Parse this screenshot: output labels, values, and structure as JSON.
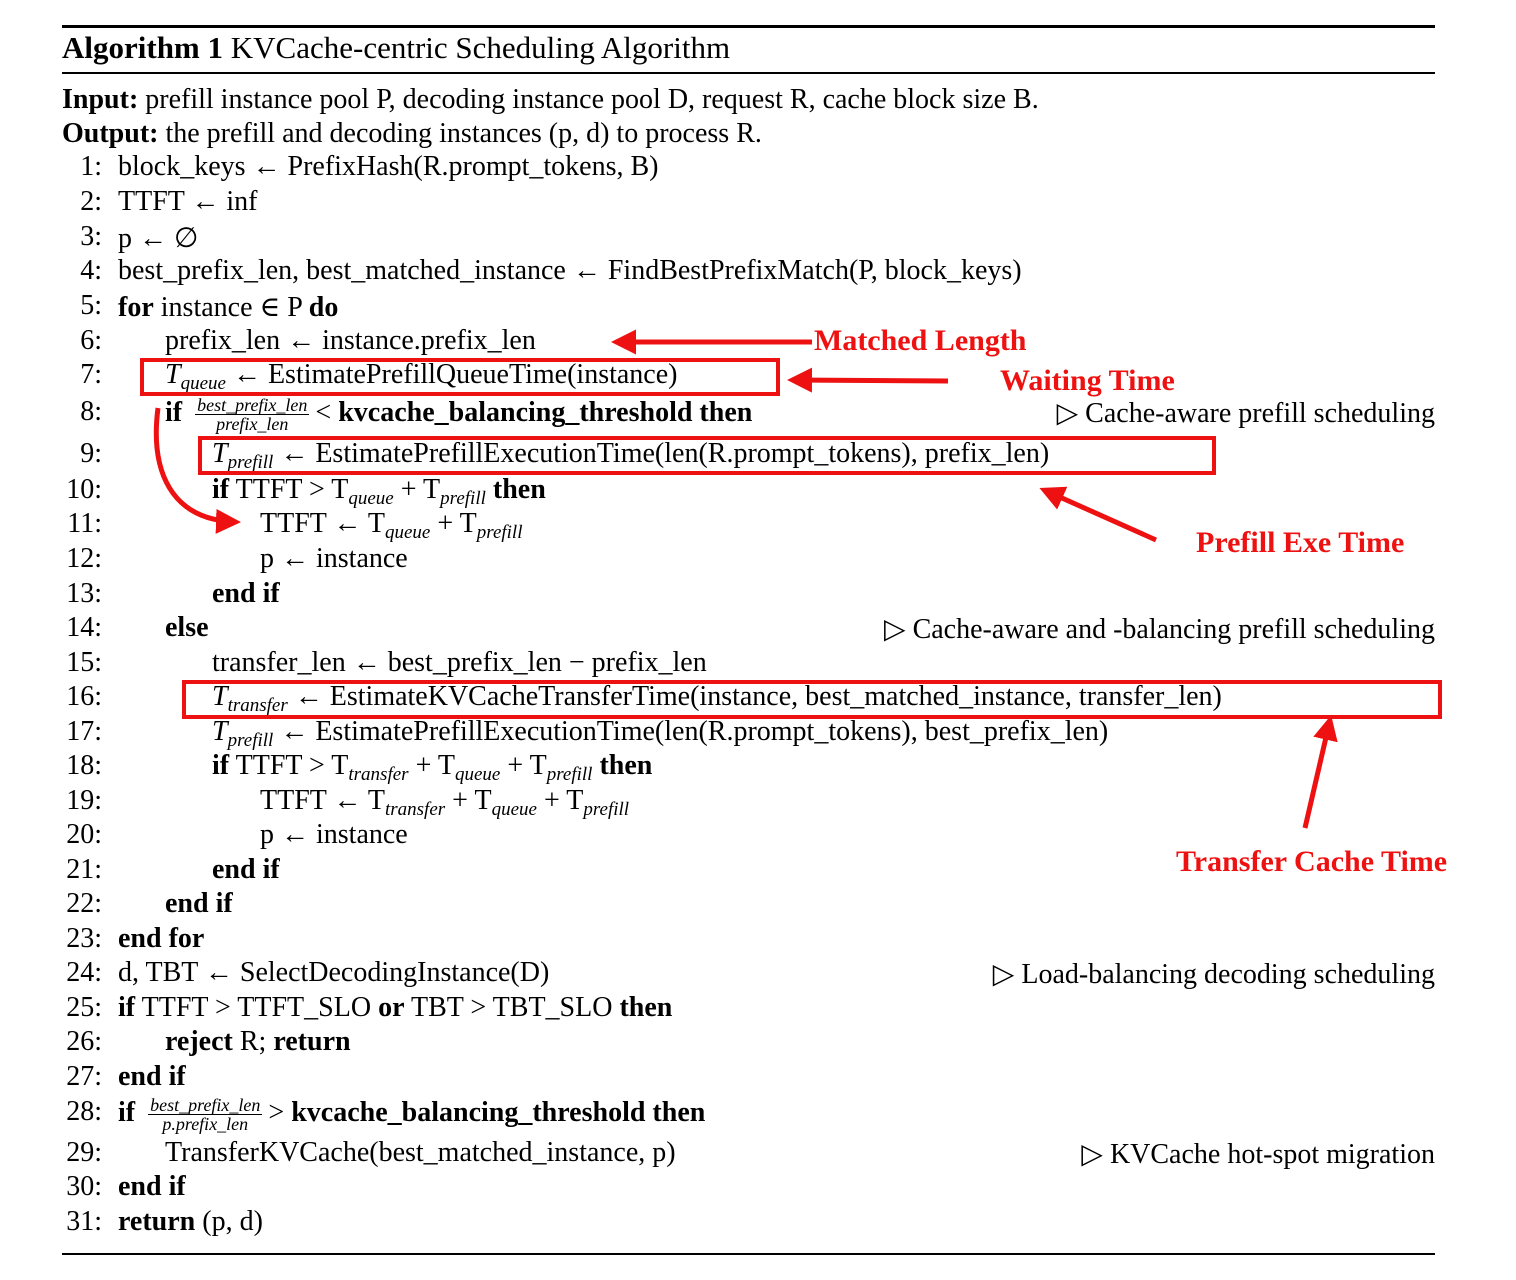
{
  "title": {
    "label": "Algorithm 1",
    "text": "KVCache-centric Scheduling Algorithm"
  },
  "input": {
    "label": "Input:",
    "text": "prefill instance pool P, decoding instance pool D, request R, cache block size B."
  },
  "output": {
    "label": "Output:",
    "text": "the prefill and decoding instances (p, d) to process R."
  },
  "lines": [
    {
      "num": "1:",
      "code": "block_keys ← PrefixHash(R.prompt_tokens, B)"
    },
    {
      "num": "2:",
      "code": "TTFT ← inf"
    },
    {
      "num": "3:",
      "code": "p ← ∅"
    },
    {
      "num": "4:",
      "code": "best_prefix_len, best_matched_instance ← FindBestPrefixMatch(P, block_keys)"
    },
    {
      "num": "5:",
      "kw": "for",
      "code": "instance ∈ P",
      "kw2": "do"
    },
    {
      "num": "6:",
      "code": "prefix_len ← instance.prefix_len"
    },
    {
      "num": "7:",
      "var": "T",
      "sub": "queue",
      "code": "← EstimatePrefillQueueTime(instance)"
    },
    {
      "num": "8:",
      "kw": "if",
      "frac_num": "best_prefix_len",
      "frac_den": "prefix_len",
      "code": "< ",
      "kw_mid": "kvcache_balancing_threshold",
      "kw2": "then",
      "comment": "Cache-aware prefill scheduling"
    },
    {
      "num": "9:",
      "var": "T",
      "sub": "prefill",
      "code": "← EstimatePrefillExecutionTime(len(R.prompt_tokens), prefix_len)"
    },
    {
      "num": "10:",
      "kw": "if",
      "code": "TTFT > T",
      "sub1": "queue",
      "code2": "+ T",
      "sub2": "prefill",
      "kw2": "then"
    },
    {
      "num": "11:",
      "code": "TTFT ← T",
      "sub1": "queue",
      "code2": "+ T",
      "sub2": "prefill"
    },
    {
      "num": "12:",
      "code": "p ← instance"
    },
    {
      "num": "13:",
      "kw": "end if"
    },
    {
      "num": "14:",
      "kw": "else",
      "comment": "Cache-aware and -balancing prefill scheduling"
    },
    {
      "num": "15:",
      "code": "transfer_len ← best_prefix_len − prefix_len"
    },
    {
      "num": "16:",
      "var": "T",
      "sub": "transfer",
      "code": "← EstimateKVCacheTransferTime(instance, best_matched_instance, transfer_len)"
    },
    {
      "num": "17:",
      "var": "T",
      "sub": "prefill",
      "code": "← EstimatePrefillExecutionTime(len(R.prompt_tokens), best_prefix_len)"
    },
    {
      "num": "18:",
      "kw": "if",
      "code": "TTFT > T",
      "sub1": "transfer",
      "code2": "+ T",
      "sub2": "queue",
      "code3": "+ T",
      "sub3": "prefill",
      "kw2": "then"
    },
    {
      "num": "19:",
      "code": "TTFT ← T",
      "sub1": "transfer",
      "code2": "+ T",
      "sub2": "queue",
      "code3": "+ T",
      "sub3": "prefill"
    },
    {
      "num": "20:",
      "code": "p ← instance"
    },
    {
      "num": "21:",
      "kw": "end if"
    },
    {
      "num": "22:",
      "kw": "end if"
    },
    {
      "num": "23:",
      "kw": "end for"
    },
    {
      "num": "24:",
      "code": "d, TBT ← SelectDecodingInstance(D)",
      "comment": "Load-balancing decoding scheduling"
    },
    {
      "num": "25:",
      "kw": "if",
      "code": "TTFT > TTFT_SLO",
      "kw_mid": "or",
      "code2": "TBT > TBT_SLO",
      "kw2": "then"
    },
    {
      "num": "26:",
      "kw": "reject",
      "code": "R;",
      "kw2": "return"
    },
    {
      "num": "27:",
      "kw": "end if"
    },
    {
      "num": "28:",
      "kw": "if",
      "frac_num": "best_prefix_len",
      "frac_den": "p.prefix_len",
      "code": "> ",
      "kw_mid": "kvcache_balancing_threshold",
      "kw2": "then"
    },
    {
      "num": "29:",
      "code": "TransferKVCache(best_matched_instance, p)",
      "comment": "KVCache hot-spot migration"
    },
    {
      "num": "30:",
      "kw": "end if"
    },
    {
      "num": "31:",
      "kw": "return",
      "code": "(p, d)"
    }
  ],
  "comment_marker": "▷",
  "annotations": {
    "matched_length": "Matched Length",
    "waiting_time": "Waiting Time",
    "prefill_exe_time": "Prefill Exe Time",
    "transfer_cache_time": "Transfer Cache Time"
  },
  "colors": {
    "annotation": "#ee1111",
    "text": "#000000"
  }
}
